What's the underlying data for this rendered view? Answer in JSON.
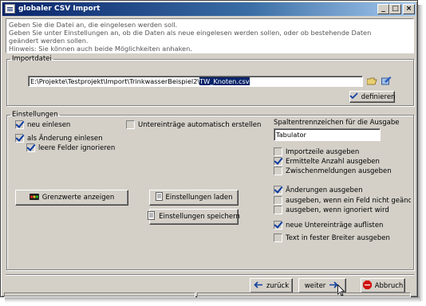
{
  "window": {
    "title": "globaler CSV Import"
  },
  "info_lines": [
    "Geben Sie die Datei an, die eingelesen werden soll.",
    "Geben Sie unter Einstellungen an, ob die Daten als neue eingelesen werden sollen, oder ob bestehende Daten",
    "geändert werden sollen.",
    "Hinweis: Sie können auch beide Möglichkeiten anhaken."
  ],
  "import": {
    "legend": "Importdatei",
    "path_prefix": "E:\\Projekte\\Testprojekt\\Import\\TrinkwasserBeispiel2\\",
    "path_selected": "TW_Knoten.csv",
    "define_label": "definieren"
  },
  "settings": {
    "legend": "Einstellungen",
    "neu_einlesen": {
      "label": "neu einlesen",
      "checked": true
    },
    "als_aenderung": {
      "label": "als Änderung einlesen",
      "checked": true
    },
    "leere_felder": {
      "label": "leere Felder ignorieren",
      "checked": true
    },
    "untereintraege": {
      "label": "Untereinträge automatisch erstellen",
      "checked": false
    },
    "grenzwerte_button": "Grenzwerte anzeigen",
    "laden_button": "Einstellungen laden",
    "speichern_button": "Einstellungen speichern",
    "separator_label": "Spaltentrennzeichen für die Ausgabe",
    "separator_value": "Tabulator",
    "options": [
      {
        "label": "Importzeile ausgeben",
        "checked": false
      },
      {
        "label": "Ermittelte Anzahl ausgeben",
        "checked": true
      },
      {
        "label": "Zwischenmeldungen ausgeben",
        "checked": false
      },
      {
        "label": "Änderungen ausgeben",
        "checked": true
      },
      {
        "label": "ausgeben, wenn ein Feld nicht geändert wu",
        "checked": false
      },
      {
        "label": "ausgeben, wenn ignoriert wird",
        "checked": false
      },
      {
        "label": "neue Untereinträge auflisten",
        "checked": true
      },
      {
        "label": "Text in fester Breiter ausgeben",
        "checked": false
      }
    ]
  },
  "nav": {
    "back_label": "zurück",
    "next_label": "weiter",
    "cancel_label": "Abbruch"
  },
  "colors": {
    "title_start": "#0a246a",
    "title_end": "#a6caf0",
    "face": "#d4d0c8",
    "selection": "#0a246a"
  }
}
